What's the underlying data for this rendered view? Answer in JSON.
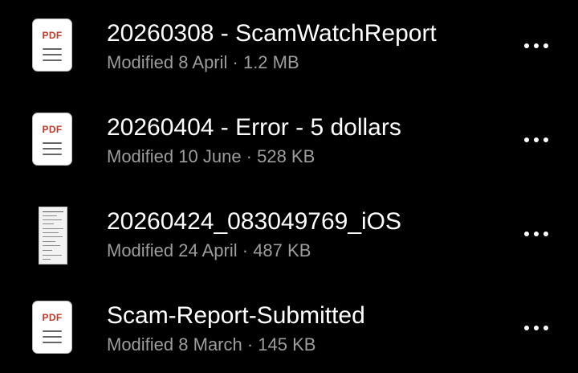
{
  "colors": {
    "background": "#000000",
    "file_name": "#ffffff",
    "meta": "#9d9d9d",
    "pdf_label": "#c0392b",
    "more_icon": "#ffffff"
  },
  "files": [
    {
      "name": "20260308 - ScamWatchReport",
      "meta": "Modified 8 April · 1.2 MB",
      "type": "pdf",
      "icon_label": "PDF",
      "icon": "pdf-file-icon",
      "more_icon": "more-options-icon"
    },
    {
      "name": "20260404 - Error - 5 dollars",
      "meta": "Modified 10 June · 528 KB",
      "type": "pdf",
      "icon_label": "PDF",
      "icon": "pdf-file-icon",
      "more_icon": "more-options-icon"
    },
    {
      "name": "20260424_083049769_iOS",
      "meta": "Modified 24 April · 487 KB",
      "type": "image",
      "icon": "document-thumbnail",
      "more_icon": "more-options-icon"
    },
    {
      "name": "Scam-Report-Submitted",
      "meta": "Modified 8 March · 145 KB",
      "type": "pdf",
      "icon_label": "PDF",
      "icon": "pdf-file-icon",
      "more_icon": "more-options-icon"
    }
  ]
}
